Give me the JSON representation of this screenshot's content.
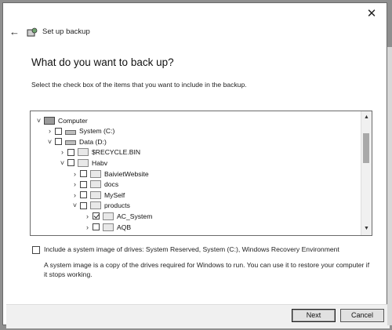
{
  "window": {
    "close_symbol": "✕",
    "back_symbol": "←",
    "title": "Set up backup",
    "title_icon": "backup-icon"
  },
  "page": {
    "heading": "What do you want to back up?",
    "instruction": "Select the check box of the items that you want to include in the backup."
  },
  "tree": {
    "items": [
      {
        "label": "Computer",
        "expander": "˅",
        "checkbox": false,
        "checked": false,
        "icon": "computer-icon"
      },
      {
        "label": "System (C:)",
        "expander": "›",
        "checkbox": true,
        "checked": false,
        "icon": "drive-icon"
      },
      {
        "label": "Data (D:)",
        "expander": "˅",
        "checkbox": true,
        "checked": false,
        "icon": "drive-icon"
      },
      {
        "label": "$RECYCLE.BIN",
        "expander": "›",
        "checkbox": true,
        "checked": false,
        "icon": "folder-icon"
      },
      {
        "label": "Habv",
        "expander": "˅",
        "checkbox": true,
        "checked": false,
        "icon": "folder-icon"
      },
      {
        "label": "BaivietWebsite",
        "expander": "›",
        "checkbox": true,
        "checked": false,
        "icon": "folder-icon"
      },
      {
        "label": "docs",
        "expander": "›",
        "checkbox": true,
        "checked": false,
        "icon": "folder-icon"
      },
      {
        "label": "MySelf",
        "expander": "›",
        "checkbox": true,
        "checked": false,
        "icon": "folder-icon"
      },
      {
        "label": "products",
        "expander": "˅",
        "checkbox": true,
        "checked": false,
        "icon": "folder-icon"
      },
      {
        "label": "AC_System",
        "expander": "›",
        "checkbox": true,
        "checked": true,
        "icon": "folder-icon"
      },
      {
        "label": "AQB",
        "expander": "›",
        "checkbox": true,
        "checked": false,
        "icon": "folder-icon"
      }
    ],
    "scroll_up": "▲",
    "scroll_down": "▼"
  },
  "system_image": {
    "checked": false,
    "label": "Include a system image of drives: System Reserved, System (C:), Windows Recovery Environment",
    "note": "A system image is a copy of the drives required for Windows to run. You can use it to restore your computer if it stops working."
  },
  "buttons": {
    "next": "Next",
    "cancel": "Cancel"
  }
}
